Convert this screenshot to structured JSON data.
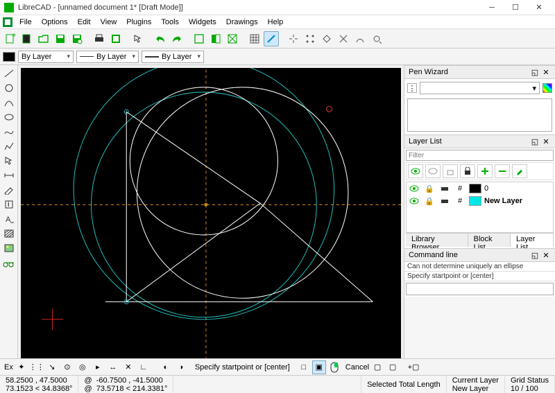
{
  "window": {
    "title": "LibreCAD - [unnamed document 1* [Draft Mode]]"
  },
  "menus": [
    "File",
    "Options",
    "Edit",
    "View",
    "Plugins",
    "Tools",
    "Widgets",
    "Drawings",
    "Help"
  ],
  "props": {
    "colorLabel": "By Layer",
    "lineLabel": "By Layer",
    "weightLabel": "By Layer"
  },
  "penWizard": {
    "title": "Pen Wizard"
  },
  "layerList": {
    "title": "Layer List",
    "filterPlaceholder": "Filter",
    "layers": [
      {
        "name": "0",
        "color": "#000000"
      },
      {
        "name": "New Layer",
        "color": "#00e5e5"
      }
    ],
    "tabs": [
      "Library Browser",
      "Block List",
      "Layer List"
    ],
    "activeTab": 2
  },
  "commandLine": {
    "title": "Command line",
    "log1": "Can not determine uniquely an ellipse",
    "prompt": "Specify startpoint or [center]"
  },
  "snapbar": {
    "ex": "Ex",
    "prompt": "Specify startpoint or [center]",
    "cancel": "Cancel"
  },
  "status": {
    "absCoord": "58.2500 , 47.5000",
    "absPolar": "73.1523 < 34.8368°",
    "relCoord": "-60.7500 , -41.5000",
    "relPolar": "73.5718 < 214.3381°",
    "selLabel": "Selected Total Length",
    "layerLabel": "Current Layer",
    "layerVal": "New Layer",
    "gridLabel": "Grid Status",
    "gridVal": "10 / 100",
    "atSym": "@"
  }
}
